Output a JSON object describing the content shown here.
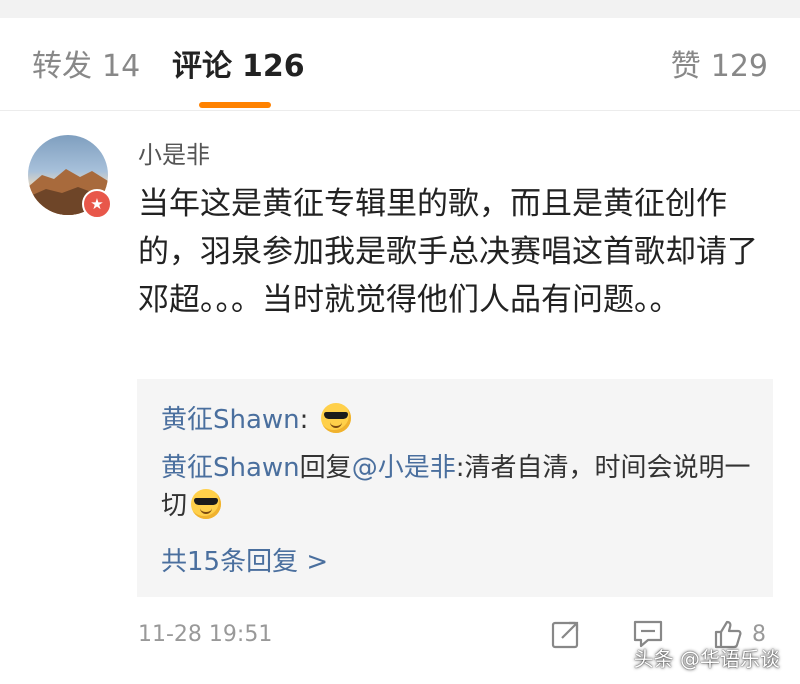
{
  "tabs": {
    "repost": {
      "label": "转发",
      "count": "14"
    },
    "comments": {
      "label": "评论",
      "count": "126"
    },
    "likes": {
      "label": "赞",
      "count": "129"
    },
    "accent_color": "#ff8200"
  },
  "comment": {
    "avatar_icon": "avatar-mountain-landscape",
    "badge_icon": "verified-badge-icon",
    "username": "小是非",
    "text": "当年这是黄征专辑里的歌，而且是黄征创作的，羽泉参加我是歌手总决赛唱这首歌却请了邓超。。。当时就觉得他们人品有问题。。",
    "timestamp": "11-28 19:51",
    "like_count": "8"
  },
  "replies": {
    "reply1_author": "黄征Shawn",
    "reply1_separator": ": ",
    "reply2_author": "黄征Shawn",
    "reply2_verb": "回复",
    "reply2_mention": "@小是非",
    "reply2_text": ":清者自清，时间会说明一切",
    "emoji_icon": "sunglasses-emoji-icon",
    "more_label": "共15条回复 >",
    "link_color": "#4a6f9e"
  },
  "watermark": "头条 @华语乐谈"
}
